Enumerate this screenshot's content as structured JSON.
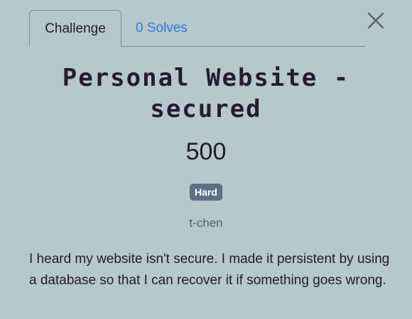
{
  "tabs": [
    {
      "label": "Challenge"
    },
    {
      "label": "0 Solves"
    }
  ],
  "close_icon": "close-icon",
  "challenge": {
    "title": "Personal Website - secured",
    "points": "500",
    "difficulty": "Hard",
    "author": "t-chen",
    "description": "I heard my website isn't secure. I made it persistent by using a database so that I can recover it if something goes wrong."
  },
  "colors": {
    "background": "#b5c8cc",
    "link": "#2f7ae5",
    "badge": "#5e6f89",
    "text": "#221a30"
  }
}
